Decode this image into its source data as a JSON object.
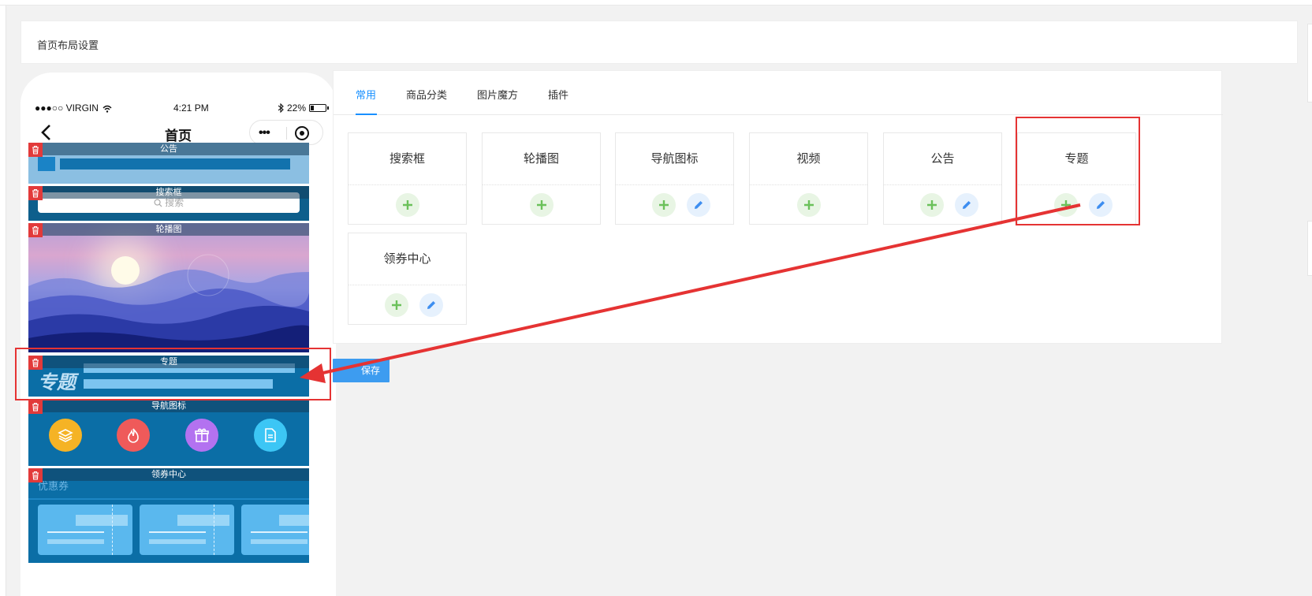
{
  "page": {
    "header_title": "首页布局设置"
  },
  "phone": {
    "status": {
      "carrier": "●●●○○ VIRGIN",
      "time": "4:21 PM",
      "battery": "22%"
    },
    "nav_title": "首页",
    "modules": {
      "notice": "公告",
      "search": "搜索框",
      "search_placeholder": "搜索",
      "carousel": "轮播图",
      "special": "专题",
      "special_big": "专题",
      "navicon": "导航图标",
      "coupon": "领券中心",
      "coupon_text": "优惠券"
    },
    "nav_icon_colors": [
      "#f5b325",
      "#ef5a5a",
      "#b372f0",
      "#3cc6f5"
    ]
  },
  "panel": {
    "tabs": [
      "常用",
      "商品分类",
      "图片魔方",
      "插件"
    ],
    "active_tab": 0,
    "cards": [
      {
        "name": "搜索框",
        "has_edit": false
      },
      {
        "name": "轮播图",
        "has_edit": false
      },
      {
        "name": "导航图标",
        "has_edit": true
      },
      {
        "name": "视频",
        "has_edit": false
      },
      {
        "name": "公告",
        "has_edit": true
      },
      {
        "name": "专题",
        "has_edit": true
      },
      {
        "name": "领券中心",
        "has_edit": true
      }
    ],
    "save_label": "保存"
  },
  "colors": {
    "accent": "#1890ff",
    "add_green": "#6bc15a",
    "edit_blue": "#3d8ef0",
    "annotation_red": "#e53333",
    "module_bg": "#0b6ea6"
  }
}
